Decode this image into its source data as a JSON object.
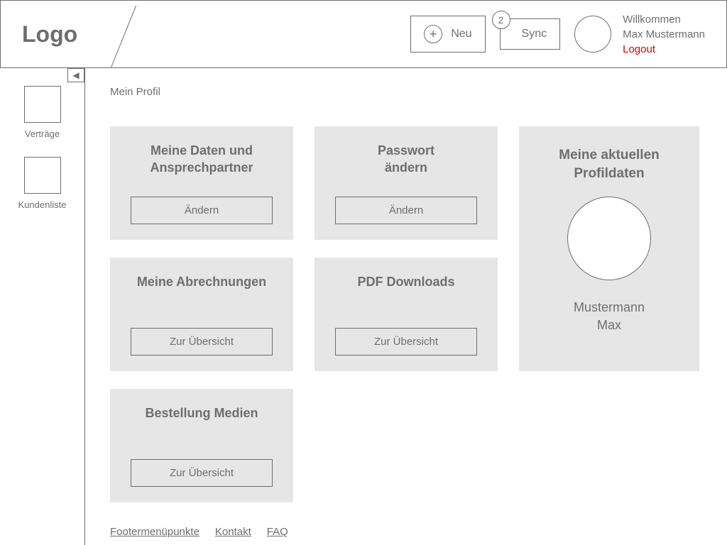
{
  "header": {
    "logo": "Logo",
    "neu_label": "Neu",
    "sync_label": "Sync",
    "sync_badge": "2",
    "welcome": "Willkommen",
    "username": "Max Mustermann",
    "logout": "Logout"
  },
  "sidebar": {
    "items": [
      {
        "label": "Verträge"
      },
      {
        "label": "Kundenliste"
      }
    ]
  },
  "page_title": "Mein Profil",
  "cards": [
    {
      "title": "Meine Daten und Ansprechpartner",
      "button": "Ändern"
    },
    {
      "title": "Passwort ändern",
      "button": "Ändern"
    },
    {
      "title": "Meine Abrechnungen",
      "button": "Zur Übersicht"
    },
    {
      "title": "PDF Downloads",
      "button": "Zur Übersicht"
    },
    {
      "title": "Bestellung Medien",
      "button": "Zur Übersicht"
    }
  ],
  "profile": {
    "title": "Meine aktuellen Profildaten",
    "name_line1": "Mustermann",
    "name_line2": "Max"
  },
  "footer": {
    "menu": "Footermenüpunkte",
    "kontakt": "Kontakt",
    "faq": "FAQ"
  }
}
